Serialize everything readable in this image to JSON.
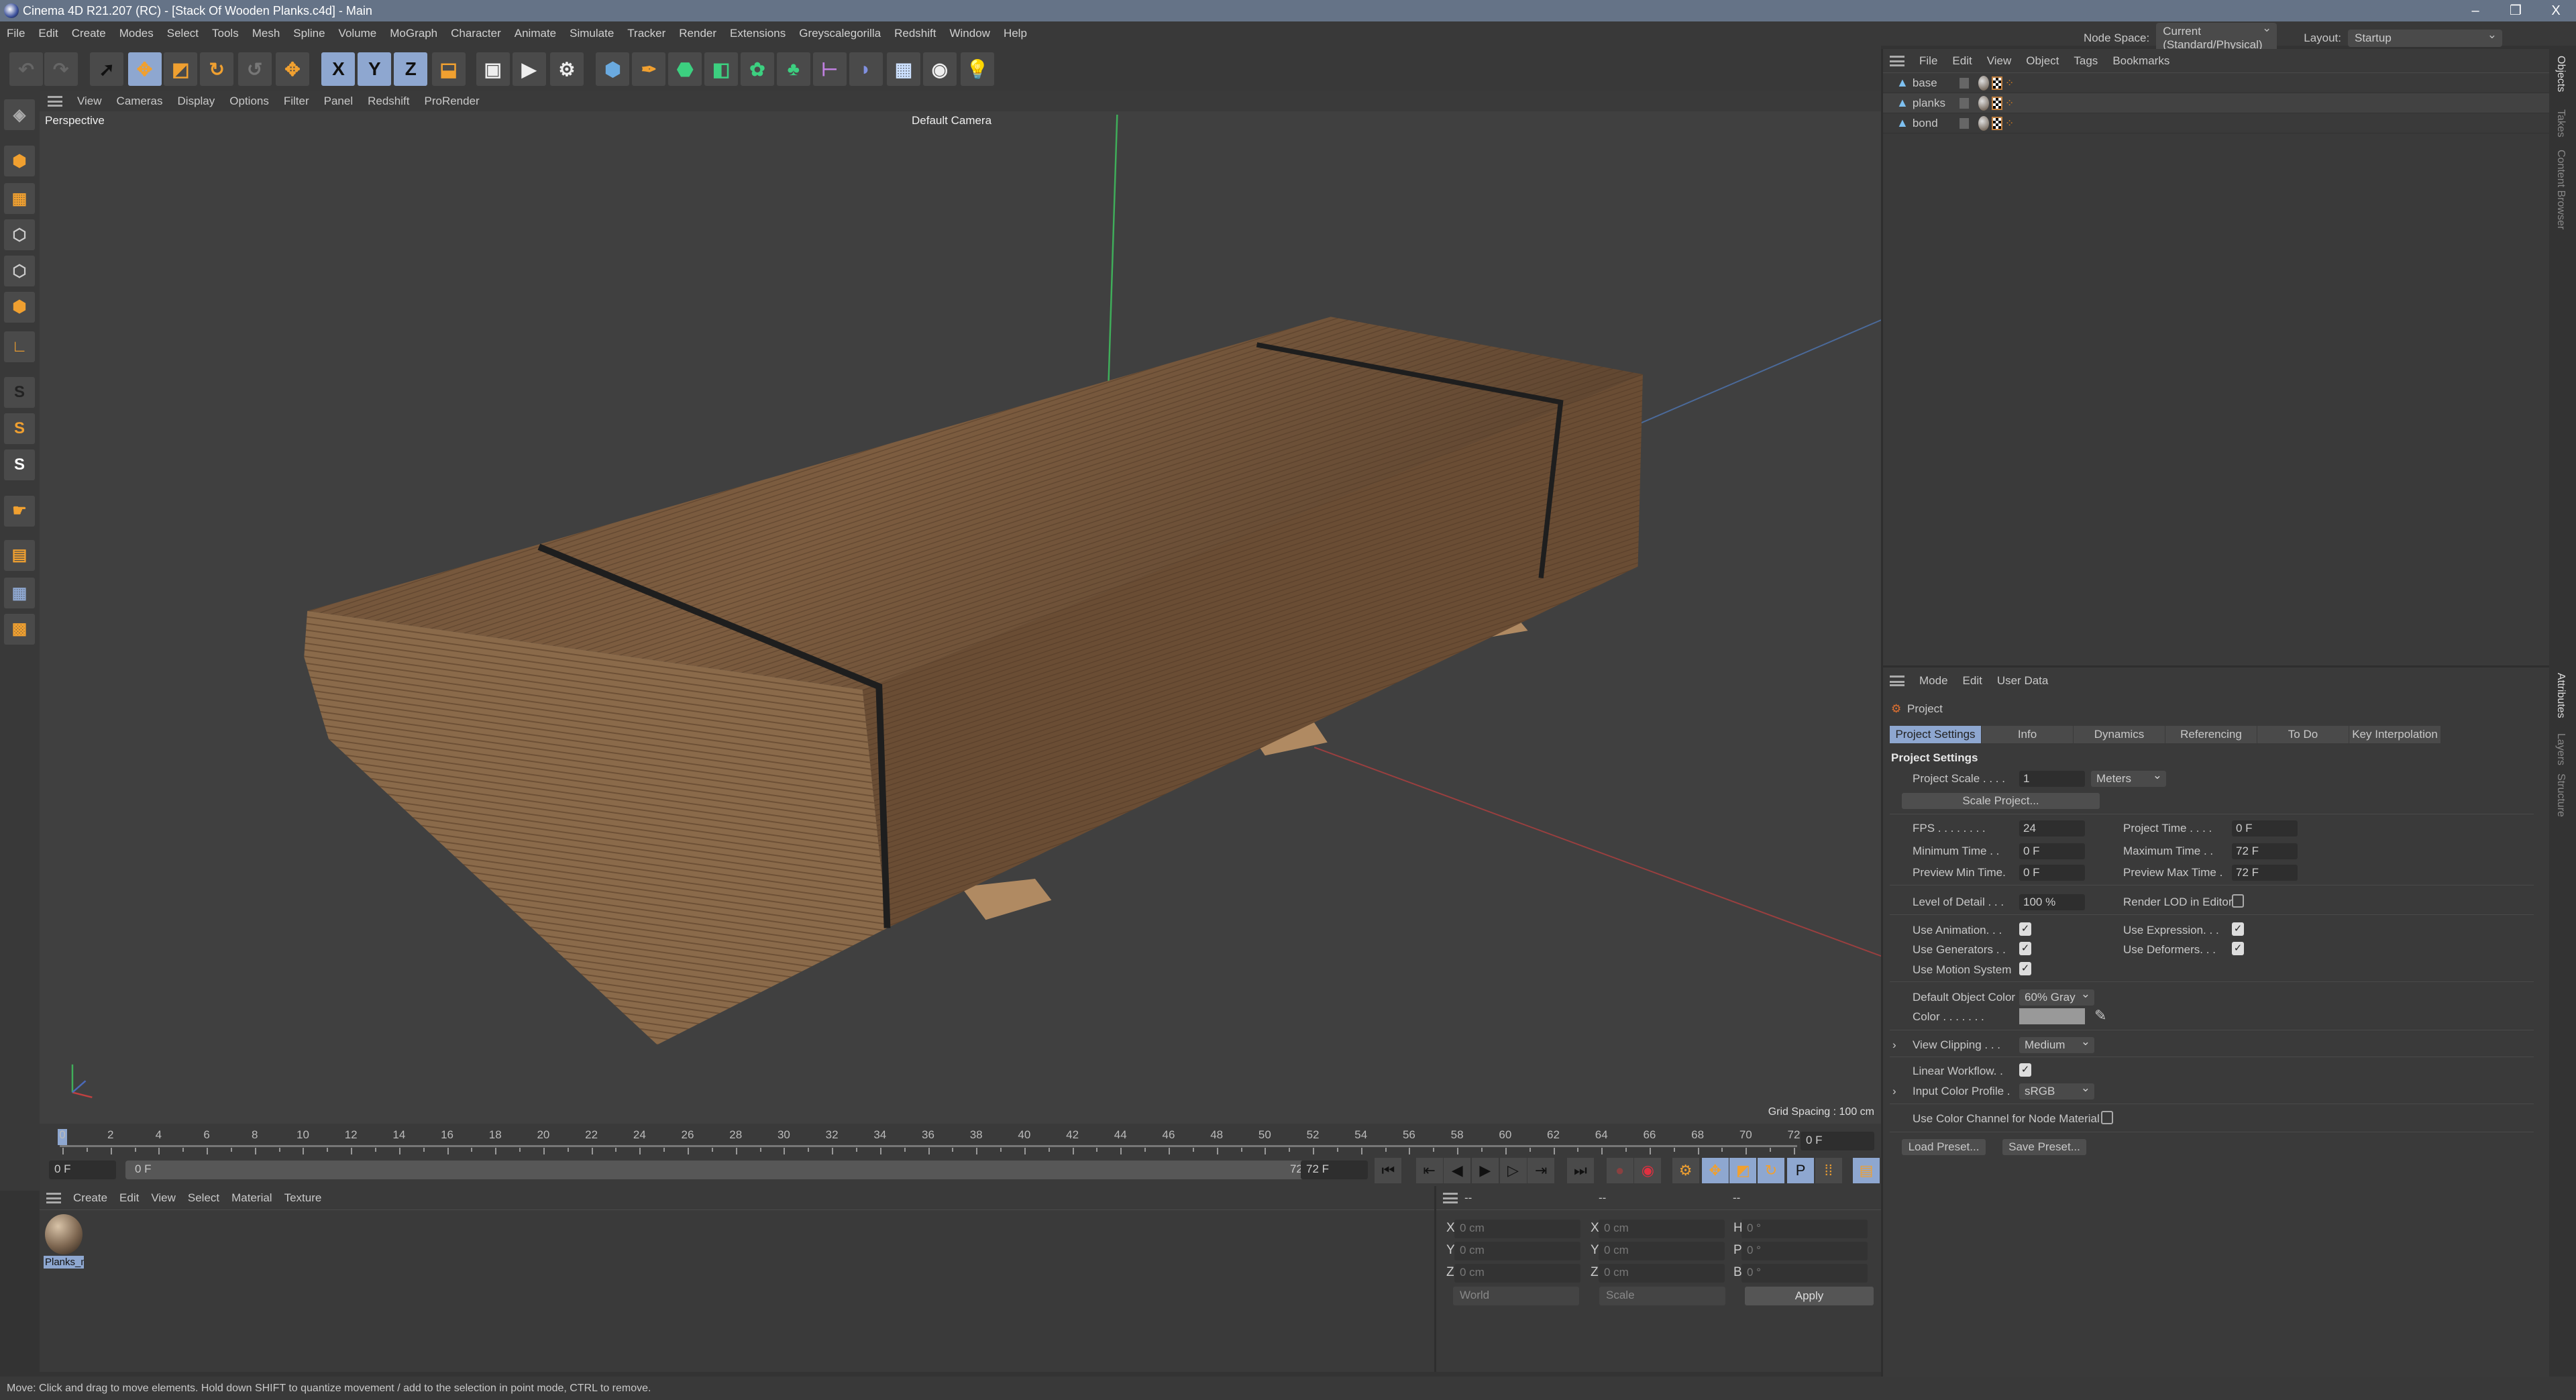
{
  "window": {
    "title": "Cinema 4D R21.207 (RC) - [Stack Of Wooden Planks.c4d] - Main",
    "minimize": "–",
    "restore": "❐",
    "close": "X"
  },
  "menubar": [
    "File",
    "Edit",
    "Create",
    "Modes",
    "Select",
    "Tools",
    "Mesh",
    "Spline",
    "Volume",
    "MoGraph",
    "Character",
    "Animate",
    "Simulate",
    "Tracker",
    "Render",
    "Extensions",
    "Greyscalegorilla",
    "Redshift",
    "Window",
    "Help"
  ],
  "node_space": {
    "label": "Node Space:",
    "value": "Current (Standard/Physical)"
  },
  "layout": {
    "label": "Layout:",
    "value": "Startup"
  },
  "toolbar": [
    {
      "name": "undo-icon",
      "glyph": "↶",
      "color": "#666"
    },
    {
      "name": "redo-icon",
      "glyph": "↷",
      "color": "#666"
    },
    {
      "name": "live-selection-icon",
      "glyph": "➚",
      "color": "#111",
      "selected": false
    },
    {
      "name": "move-icon",
      "glyph": "✥",
      "color": "#f0a030",
      "selected": true
    },
    {
      "name": "scale-icon",
      "glyph": "◩",
      "color": "#f0a030"
    },
    {
      "name": "rotate-icon",
      "glyph": "↻",
      "color": "#f0a030"
    },
    {
      "name": "psr-icon",
      "glyph": "↺",
      "color": "#777"
    },
    {
      "name": "world-axis-icon",
      "glyph": "✥",
      "color": "#f0a030"
    },
    {
      "name": "x-axis-icon",
      "glyph": "X",
      "color": "#111",
      "selected": true
    },
    {
      "name": "y-axis-icon",
      "glyph": "Y",
      "color": "#111",
      "selected": true
    },
    {
      "name": "z-axis-icon",
      "glyph": "Z",
      "color": "#111",
      "selected": true
    },
    {
      "name": "coordinate-system-icon",
      "glyph": "⬓",
      "color": "#f0a030"
    },
    {
      "name": "render-view-icon",
      "glyph": "▣",
      "color": "#eee"
    },
    {
      "name": "render-picture-viewer-icon",
      "glyph": "▶",
      "color": "#eee"
    },
    {
      "name": "render-settings-icon",
      "glyph": "⚙",
      "color": "#eee"
    },
    {
      "name": "cube-icon",
      "glyph": "⬢",
      "color": "#6aaae0"
    },
    {
      "name": "pen-icon",
      "glyph": "✒",
      "color": "#f0a030"
    },
    {
      "name": "subdivision-icon",
      "glyph": "⬣",
      "color": "#3cd080"
    },
    {
      "name": "extrude-icon",
      "glyph": "◧",
      "color": "#3cd080"
    },
    {
      "name": "cloner-icon",
      "glyph": "✿",
      "color": "#3cd080"
    },
    {
      "name": "mograph-icon",
      "glyph": "♣",
      "color": "#3cd080"
    },
    {
      "name": "deformer-icon",
      "glyph": "⊢",
      "color": "#c080e0"
    },
    {
      "name": "field-icon",
      "glyph": "◗",
      "color": "#8090e0"
    },
    {
      "name": "floor-icon",
      "glyph": "▦",
      "color": "#cce0ff"
    },
    {
      "name": "camera-icon",
      "glyph": "◉",
      "color": "#eee"
    },
    {
      "name": "light-icon",
      "glyph": "💡",
      "color": "#eee"
    }
  ],
  "left_tools": [
    {
      "name": "make-editable-icon",
      "glyph": "◈",
      "color": "#aaa"
    },
    {
      "name": "model-mode-icon",
      "glyph": "⬢",
      "color": "#f0a030"
    },
    {
      "name": "texture-mode-icon",
      "glyph": "▦",
      "color": "#f0a030"
    },
    {
      "name": "points-mode-icon",
      "glyph": "⬡",
      "color": "#ccc"
    },
    {
      "name": "edges-mode-icon",
      "glyph": "⬡",
      "color": "#ccc"
    },
    {
      "name": "polygons-mode-icon",
      "glyph": "⬢",
      "color": "#f0a030"
    },
    {
      "name": "axis-mode-icon",
      "glyph": "∟",
      "color": "#f0a030"
    },
    {
      "name": "snap-icon",
      "glyph": "S",
      "color": "#222"
    },
    {
      "name": "snap-settings-icon",
      "glyph": "S",
      "color": "#f0a030"
    },
    {
      "name": "snap-workplane-icon",
      "glyph": "S",
      "color": "#fff"
    },
    {
      "name": "tweak-icon",
      "glyph": "☛",
      "color": "#f0a030"
    },
    {
      "name": "workplane-icon",
      "glyph": "▤",
      "color": "#f0a030"
    },
    {
      "name": "grid-icon",
      "glyph": "▦",
      "color": "#8ea7d0"
    },
    {
      "name": "lock-workplane-icon",
      "glyph": "▩",
      "color": "#f0a030"
    }
  ],
  "viewport": {
    "menu": [
      "View",
      "Cameras",
      "Display",
      "Options",
      "Filter",
      "Panel",
      "Redshift",
      "ProRender"
    ],
    "projection": "Perspective",
    "camera": "Default Camera",
    "grid_spacing": "Grid Spacing : 100 cm",
    "colors": {
      "background": "#404040",
      "wood_top": "#7a5a3e",
      "wood_end": "#8a6a4a",
      "strap": "#1e1e1e"
    }
  },
  "timeline": {
    "min_frame": 0,
    "max_frame": 72,
    "label_step": 2,
    "current_frame": 0,
    "current": "0 F",
    "start": "0 F",
    "range_start": "0 F",
    "range_end": "72 F",
    "end": "72 F"
  },
  "transport": [
    {
      "name": "go-to-start-icon",
      "glyph": "⏮"
    },
    {
      "name": "previous-key-icon",
      "glyph": "⇤"
    },
    {
      "name": "previous-frame-icon",
      "glyph": "◀"
    },
    {
      "name": "play-icon",
      "glyph": "▶"
    },
    {
      "name": "next-frame-icon",
      "glyph": "▷"
    },
    {
      "name": "next-key-icon",
      "glyph": "⇥"
    },
    {
      "name": "go-to-end-icon",
      "glyph": "⏭"
    },
    {
      "name": "record-icon",
      "glyph": "●",
      "color": "#8a4040"
    },
    {
      "name": "autokey-icon",
      "glyph": "◉",
      "color": "#e03040"
    },
    {
      "name": "keyframe-selection-icon",
      "glyph": "⚙",
      "color": "#f0a030"
    },
    {
      "name": "key-position-icon",
      "glyph": "✥",
      "color": "#f0a030",
      "selected": true
    },
    {
      "name": "key-scale-icon",
      "glyph": "◩",
      "color": "#f0a030",
      "selected": true
    },
    {
      "name": "key-rotation-icon",
      "glyph": "↻",
      "color": "#f0a030",
      "selected": true
    },
    {
      "name": "key-parameter-icon",
      "glyph": "P",
      "color": "#111",
      "selected": true
    },
    {
      "name": "key-pla-icon",
      "glyph": "⁞⁞",
      "color": "#f0a030"
    },
    {
      "name": "timeline-window-icon",
      "glyph": "▤",
      "color": "#f0a030",
      "selected": true
    }
  ],
  "material_manager": {
    "menu": [
      "Create",
      "Edit",
      "View",
      "Select",
      "Material",
      "Texture"
    ],
    "materials": [
      {
        "name": "Planks_m"
      }
    ]
  },
  "coordinates": {
    "headers": [
      "--",
      "--",
      "--"
    ],
    "rows": [
      {
        "a": "X",
        "a_val": "0 cm",
        "b": "X",
        "b_val": "0 cm",
        "c": "H",
        "c_val": "0 °"
      },
      {
        "a": "Y",
        "a_val": "0 cm",
        "b": "Y",
        "b_val": "0 cm",
        "c": "P",
        "c_val": "0 °"
      },
      {
        "a": "Z",
        "a_val": "0 cm",
        "b": "Z",
        "b_val": "0 cm",
        "c": "B",
        "c_val": "0 °"
      }
    ],
    "space": "World",
    "mode": "Scale",
    "apply": "Apply"
  },
  "status": "Move: Click and drag to move elements. Hold down SHIFT to quantize movement / add to the selection in point mode, CTRL to remove.",
  "object_manager": {
    "menu": [
      "File",
      "Edit",
      "View",
      "Object",
      "Tags",
      "Bookmarks"
    ],
    "objects": [
      {
        "name": "base"
      },
      {
        "name": "planks"
      },
      {
        "name": "bond"
      }
    ]
  },
  "side_tabs": {
    "top": [
      "Objects",
      "Takes",
      "Content Browser"
    ],
    "bottom": [
      "Attributes",
      "Layers",
      "Structure"
    ]
  },
  "attributes": {
    "menu": [
      "Mode",
      "Edit",
      "User Data"
    ],
    "object": "Project",
    "tabs": [
      "Project Settings",
      "Info",
      "Dynamics",
      "Referencing",
      "To Do",
      "Key Interpolation"
    ],
    "active_tab": 0,
    "heading": "Project Settings",
    "project_scale": {
      "label": "Project Scale . . . .",
      "value": "1",
      "unit": "Meters"
    },
    "scale_project": "Scale Project...",
    "fps": {
      "label": "FPS . . . . . . . .",
      "value": "24"
    },
    "project_time": {
      "label": "Project Time . . . .",
      "value": "0 F"
    },
    "min_time": {
      "label": "Minimum Time . .",
      "value": "0 F"
    },
    "max_time": {
      "label": "Maximum Time . .",
      "value": "72 F"
    },
    "preview_min": {
      "label": "Preview Min Time.",
      "value": "0 F"
    },
    "preview_max": {
      "label": "Preview Max Time .",
      "value": "72 F"
    },
    "lod": {
      "label": "Level of Detail . . .",
      "value": "100 %"
    },
    "render_lod": {
      "label": "Render LOD in Editor",
      "checked": false
    },
    "use_animation": {
      "label": "Use Animation. . .",
      "checked": true
    },
    "use_expression": {
      "label": "Use Expression. . .",
      "checked": true
    },
    "use_generators": {
      "label": "Use Generators . .",
      "checked": true
    },
    "use_deformers": {
      "label": "Use Deformers. . .",
      "checked": true
    },
    "use_motion": {
      "label": "Use Motion System",
      "checked": true
    },
    "default_color": {
      "label": "Default Object Color",
      "value": "60% Gray"
    },
    "color": {
      "label": "Color . . . . . . .",
      "swatch": "#999999"
    },
    "view_clipping": {
      "label": "View Clipping . . .",
      "value": "Medium"
    },
    "linear_workflow": {
      "label": "Linear Workflow. .",
      "checked": true
    },
    "input_profile": {
      "label": "Input Color Profile .",
      "value": "sRGB"
    },
    "color_channel": {
      "label": "Use Color Channel for Node Material",
      "checked": false
    },
    "load_preset": "Load Preset...",
    "save_preset": "Save Preset...",
    "check_glyph": "✓"
  }
}
